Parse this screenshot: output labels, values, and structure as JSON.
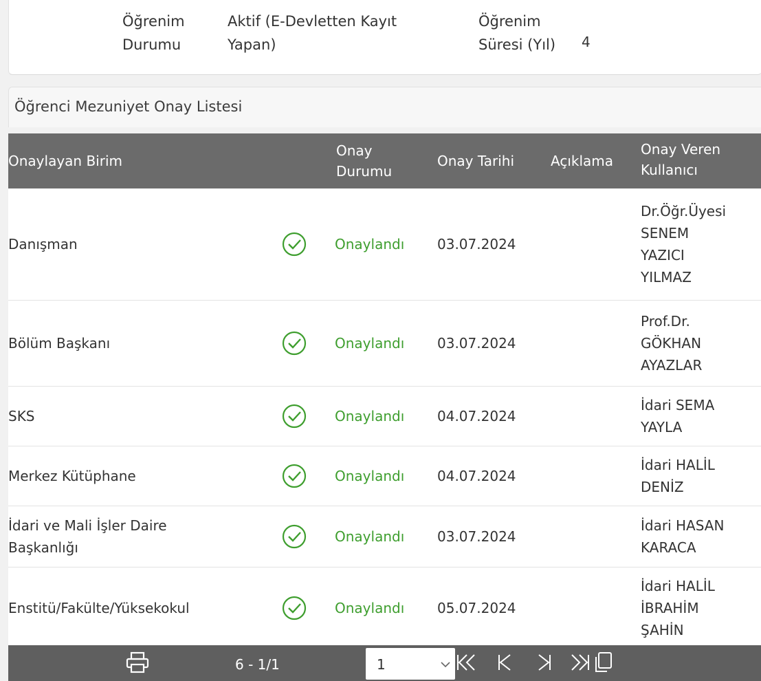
{
  "info": {
    "c1_l1": "Öğrenim",
    "c1_l2": "Durumu",
    "c2_l1": "Aktif (E-Devletten Kayıt",
    "c2_l2": "Yapan)",
    "c3_l1": "Öğrenim",
    "c3_l2": "Süresi (Yıl)",
    "c4": "4"
  },
  "list": {
    "title": "Öğrenci Mezuniyet Onay Listesi"
  },
  "table": {
    "headers": {
      "unit": "Onaylayan Birim",
      "status_l1": "Onay",
      "status_l2": "Durumu",
      "date": "Onay Tarihi",
      "note": "Açıklama",
      "user_l1": "Onay Veren",
      "user_l2": "Kullanıcı"
    },
    "rows": [
      {
        "unit_l1": "Danışman",
        "unit_l2": "",
        "status": "Onaylandı",
        "date": "03.07.2024",
        "note": "",
        "user_lines": [
          "Dr.Öğr.Üyesi",
          "SENEM",
          "YAZICI",
          "YILMAZ"
        ]
      },
      {
        "unit_l1": "Bölüm Başkanı",
        "unit_l2": "",
        "status": "Onaylandı",
        "date": "03.07.2024",
        "note": "",
        "user_lines": [
          "Prof.Dr.",
          "GÖKHAN",
          "AYAZLAR"
        ]
      },
      {
        "unit_l1": "SKS",
        "unit_l2": "",
        "status": "Onaylandı",
        "date": "04.07.2024",
        "note": "",
        "user_lines": [
          "İdari SEMA",
          "YAYLA"
        ]
      },
      {
        "unit_l1": "Merkez Kütüphane",
        "unit_l2": "",
        "status": "Onaylandı",
        "date": "04.07.2024",
        "note": "",
        "user_lines": [
          "İdari HALİL",
          "DENİZ"
        ]
      },
      {
        "unit_l1": "İdari ve Mali İşler Daire",
        "unit_l2": "Başkanlığı",
        "status": "Onaylandı",
        "date": "03.07.2024",
        "note": "",
        "user_lines": [
          "İdari HASAN",
          "KARACA"
        ]
      },
      {
        "unit_l1": "Enstitü/Fakülte/Yüksekokul",
        "unit_l2": "",
        "status": "Onaylandı",
        "date": "05.07.2024",
        "note": "",
        "user_lines": [
          "İdari HALİL",
          "İBRAHİM",
          "ŞAHİN"
        ]
      }
    ]
  },
  "footer": {
    "page_info": "6 - 1/1",
    "page_select_value": "1",
    "icons": [
      "printer-icon",
      "first-page-icon",
      "prev-page-icon",
      "next-page-icon",
      "last-page-icon",
      "copy-icon"
    ]
  },
  "colors": {
    "header_bg": "#6b6b6b",
    "footer_bg": "#5f5f5f",
    "approved_green": "#3e9e2e"
  }
}
